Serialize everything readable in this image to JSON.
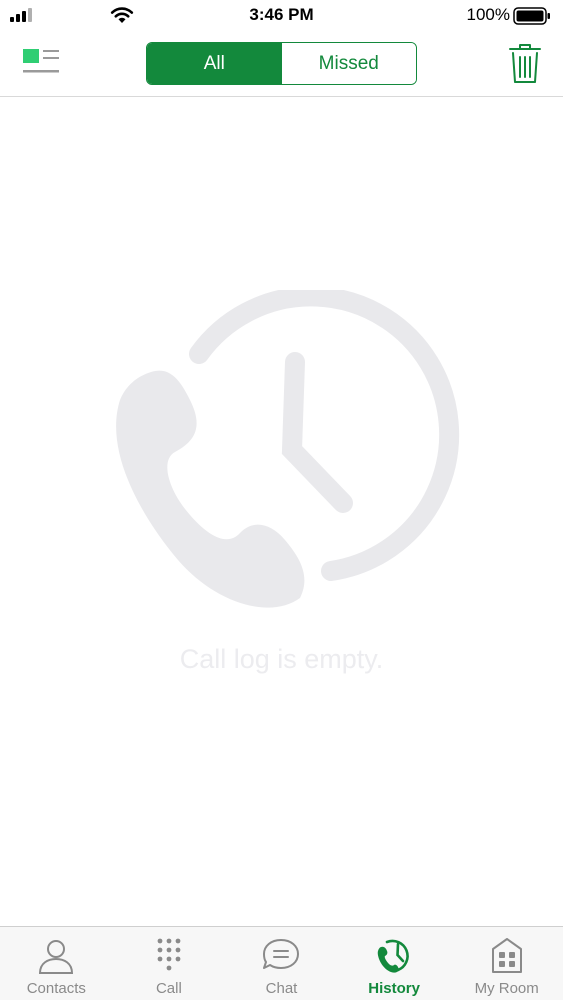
{
  "status_bar": {
    "time": "3:46 PM",
    "battery_percent": "100%",
    "icons": [
      "signal-icon",
      "wifi-icon",
      "battery-icon"
    ]
  },
  "top_nav": {
    "menu_icon": "menu-toggle-icon",
    "filter_tabs": [
      {
        "label": "All",
        "selected": true
      },
      {
        "label": "Missed",
        "selected": false
      }
    ],
    "delete_icon": "trash-icon"
  },
  "empty_state": {
    "icon": "phone-clock-icon",
    "message": "Call log is empty."
  },
  "tab_bar": {
    "items": [
      {
        "label": "Contacts",
        "icon": "contact-icon",
        "active": false
      },
      {
        "label": "Call",
        "icon": "dialpad-icon",
        "active": false
      },
      {
        "label": "Chat",
        "icon": "chat-bubble-icon",
        "active": false
      },
      {
        "label": "History",
        "icon": "history-icon",
        "active": true
      },
      {
        "label": "My Room",
        "icon": "room-icon",
        "active": false
      }
    ]
  },
  "colors": {
    "accent": "#13893c",
    "inactive_label": "#8a8a8a",
    "illustration": "#e9e9ec",
    "tab_bar_bg": "#f7f7f7"
  }
}
